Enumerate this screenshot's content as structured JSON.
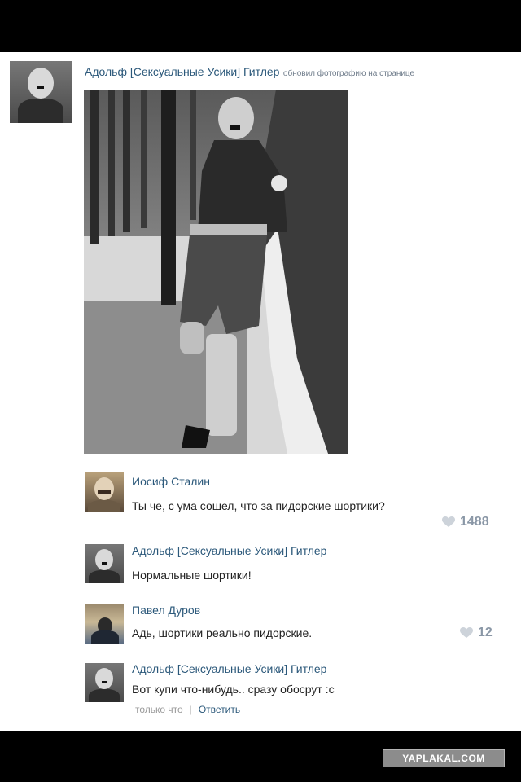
{
  "post": {
    "author": "Адольф [Сексуальные Усики] Гитлер",
    "action": "обновил фотографию на странице"
  },
  "comments": [
    {
      "author": "Иосиф Сталин",
      "text": "Ты че, с ума сошел, что за пидорские шортики?",
      "likes": "1488"
    },
    {
      "author": "Адольф [Сексуальные Усики] Гитлер",
      "text": "Нормальные шортики!"
    },
    {
      "author": "Павел Дуров",
      "text": "Адь, шортики реально пидорские.",
      "likes": "12"
    },
    {
      "author": "Адольф [Сексуальные Усики] Гитлер",
      "text": "Вот купи что-нибудь.. сразу обосрут :с",
      "meta": "только что",
      "reply_label": "Ответить"
    }
  ],
  "watermark": "YAPLAKAL.COM",
  "colors": {
    "link": "#2b587a",
    "meta": "#999999",
    "likes": "#8a97a6",
    "background": "#ffffff"
  },
  "icons": [
    "heart-icon"
  ]
}
